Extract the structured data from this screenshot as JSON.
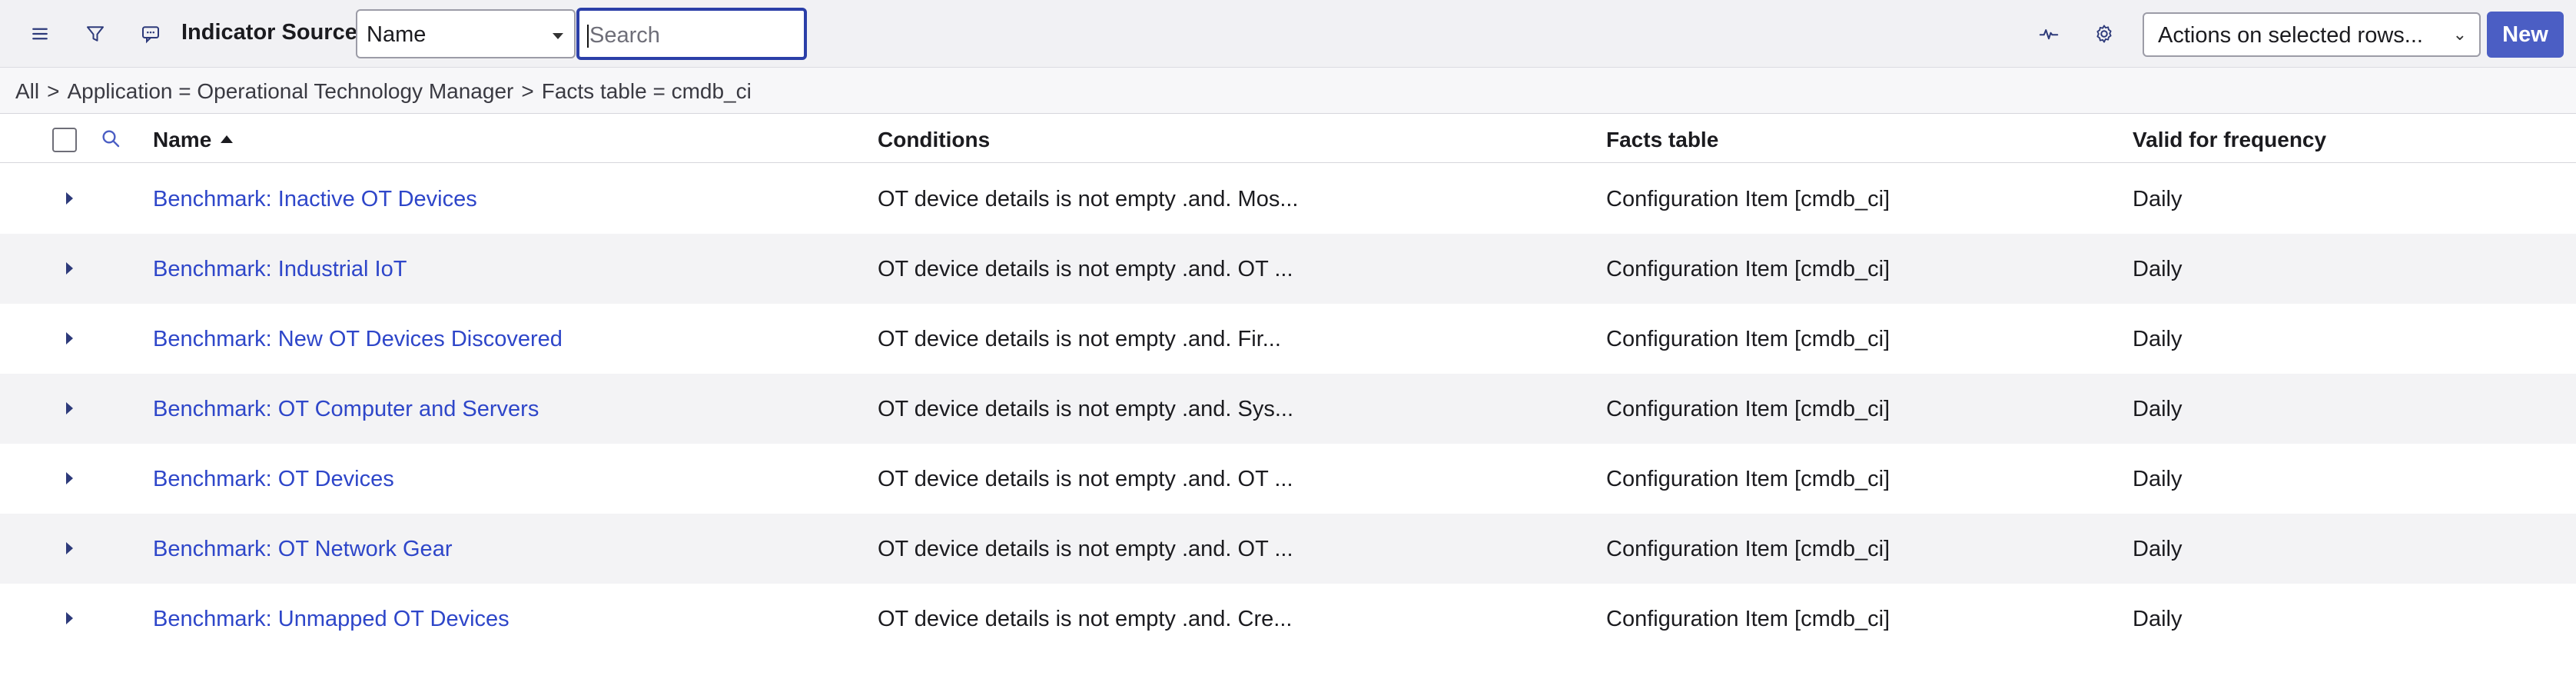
{
  "toolbar": {
    "menu_icon": "hamburger-menu-icon",
    "filter_icon": "filter-icon",
    "chat_icon": "chat-bubble-icon",
    "title": "Indicator Sources",
    "search_field_select": "Name",
    "search_placeholder": "Search",
    "activity_icon": "activity-pulse-icon",
    "settings_icon": "gear-icon",
    "actions_select": "Actions on selected rows...",
    "new_button": "New"
  },
  "breadcrumb": {
    "items": [
      "All",
      "Application = Operational Technology Manager",
      "Facts table = cmdb_ci"
    ],
    "separator": ">"
  },
  "table": {
    "columns": [
      "Name",
      "Conditions",
      "Facts table",
      "Valid for frequency"
    ],
    "sort": "ascending",
    "rows": [
      {
        "name": "Benchmark: Inactive OT Devices",
        "conditions": "OT device details is not empty .and. Mos...",
        "facts_table": "Configuration Item [cmdb_ci]",
        "frequency": "Daily"
      },
      {
        "name": "Benchmark: Industrial IoT",
        "conditions": "OT device details is not empty .and. OT ...",
        "facts_table": "Configuration Item [cmdb_ci]",
        "frequency": "Daily"
      },
      {
        "name": "Benchmark: New OT Devices Discovered",
        "conditions": "OT device details is not empty .and. Fir...",
        "facts_table": "Configuration Item [cmdb_ci]",
        "frequency": "Daily"
      },
      {
        "name": "Benchmark: OT Computer and Servers",
        "conditions": "OT device details is not empty .and. Sys...",
        "facts_table": "Configuration Item [cmdb_ci]",
        "frequency": "Daily"
      },
      {
        "name": "Benchmark: OT Devices",
        "conditions": "OT device details is not empty .and. OT ...",
        "facts_table": "Configuration Item [cmdb_ci]",
        "frequency": "Daily"
      },
      {
        "name": "Benchmark: OT Network Gear",
        "conditions": "OT device details is not empty .and. OT ...",
        "facts_table": "Configuration Item [cmdb_ci]",
        "frequency": "Daily"
      },
      {
        "name": "Benchmark: Unmapped OT Devices",
        "conditions": "OT device details is not empty .and. Cre...",
        "facts_table": "Configuration Item [cmdb_ci]",
        "frequency": "Daily"
      }
    ]
  },
  "colors": {
    "accent": "#4b5ec4",
    "link": "#2e46c9",
    "toolbar_bg": "#f1f1f4",
    "alt_row_bg": "#f3f3f5"
  }
}
